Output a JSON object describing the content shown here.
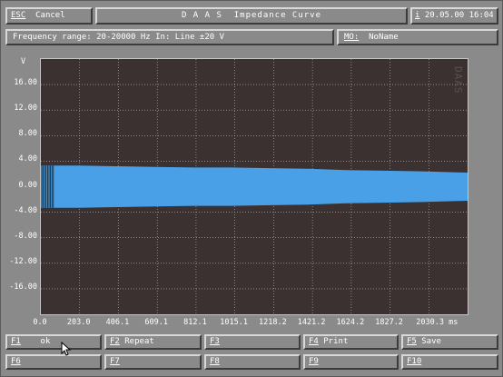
{
  "header": {
    "esc_key": "ESC",
    "esc_label": "Cancel",
    "title": "D A A S  Impedance Curve",
    "info_key": "i",
    "datetime": "20.05.00 16:04"
  },
  "info_bar": {
    "range_text": "Frequency range: 20-20000 Hz  In: Line  ±20 V",
    "mo_key": "MO:",
    "mo_value": "NoName"
  },
  "chart_data": {
    "type": "area",
    "ylabel": "V",
    "xlabel": "ms",
    "ylim": [
      -20,
      20
    ],
    "xlim": [
      0,
      2233
    ],
    "y_ticks": [
      "16.00",
      "12.00",
      "8.00",
      "4.00",
      "0.00",
      "-4.00",
      "-8.00",
      "-12.00",
      "-16.00"
    ],
    "y_tick_values": [
      16,
      12,
      8,
      4,
      0,
      -4,
      -8,
      -12,
      -16
    ],
    "x_ticks": [
      "0.0",
      "203.0",
      "406.1",
      "609.1",
      "812.1",
      "1015.1",
      "1218.2",
      "1421.2",
      "1624.2",
      "1827.2",
      "2030.3 ms"
    ],
    "x_tick_values": [
      0,
      203.0,
      406.1,
      609.1,
      812.1,
      1015.1,
      1218.2,
      1421.2,
      1624.2,
      1827.2,
      2030.3
    ],
    "envelope": {
      "x": [
        0,
        200,
        400,
        600,
        800,
        1000,
        1200,
        1400,
        1600,
        1800,
        2000,
        2233
      ],
      "upper": [
        3.3,
        3.3,
        3.2,
        3.1,
        3.0,
        3.0,
        2.9,
        2.8,
        2.6,
        2.5,
        2.4,
        2.2
      ],
      "lower": [
        -3.3,
        -3.3,
        -3.2,
        -3.1,
        -3.0,
        -3.0,
        -2.9,
        -2.8,
        -2.6,
        -2.5,
        -2.4,
        -2.2
      ]
    },
    "grid": true,
    "watermark": "DAAS"
  },
  "colors": {
    "plot_bg": "#3a3130",
    "signal": "#4aa0e6",
    "grid": "#bdbdbd"
  },
  "function_keys": [
    {
      "key": "F1",
      "label": "ok"
    },
    {
      "key": "F2",
      "label": "Repeat"
    },
    {
      "key": "F3",
      "label": ""
    },
    {
      "key": "F4",
      "label": "Print"
    },
    {
      "key": "F5",
      "label": "Save"
    },
    {
      "key": "F6",
      "label": ""
    },
    {
      "key": "F7",
      "label": ""
    },
    {
      "key": "F8",
      "label": ""
    },
    {
      "key": "F9",
      "label": ""
    },
    {
      "key": "F10",
      "label": ""
    }
  ]
}
